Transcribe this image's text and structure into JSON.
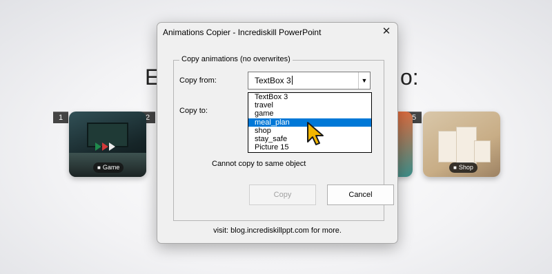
{
  "slide": {
    "title_left": "E",
    "title_right": "o:",
    "cards": [
      {
        "number": "1"
      },
      {
        "number": "2",
        "tag": "Game",
        "icon": "gamepad-icon"
      },
      {
        "number": "5",
        "tag": "Shop",
        "icon": "bag-icon"
      }
    ]
  },
  "dialog": {
    "title": "Animations Copier - Incrediskill PowerPoint",
    "close_icon": "✕",
    "group_label": "Copy animations (no overwrites)",
    "copy_from_label": "Copy from:",
    "copy_to_label": "Copy to:",
    "copy_from_value": "TextBox 3",
    "dropdown_items": [
      "TextBox 3",
      "travel",
      "game",
      "meal_plan",
      "shop",
      "stay_safe",
      "Picture 15"
    ],
    "selected_item": "meal_plan",
    "warning": "Cannot copy to same object",
    "copy_button": "Copy",
    "cancel_button": "Cancel",
    "footer": "visit: blog.incrediskillppt.com for more."
  },
  "colors": {
    "selection": "#0078d7",
    "cursor": "#f2b600"
  }
}
